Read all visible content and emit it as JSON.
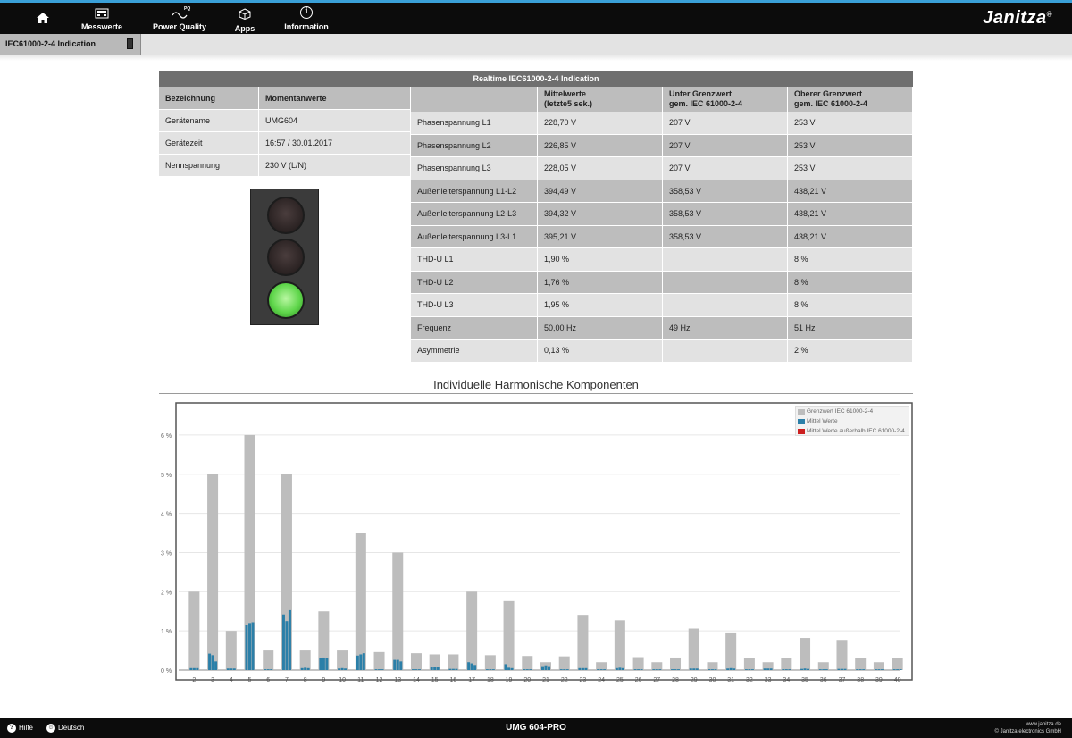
{
  "nav": {
    "items": [
      {
        "label": "Messwerte",
        "icon": "meter-icon"
      },
      {
        "label": "Power Quality",
        "icon": "pq-icon",
        "badge": "PQ"
      },
      {
        "label": "Apps",
        "icon": "cube-icon"
      },
      {
        "label": "Information",
        "icon": "info-icon",
        "glyph": "i"
      }
    ],
    "brand": "Janitza",
    "brand_mark": "®"
  },
  "subbar": {
    "tab_label": "IEC61000-2-4 Indication"
  },
  "panel": {
    "title": "Realtime IEC61000-2-4 Indication",
    "left_headers": [
      "Bezeichnung",
      "Momentanwerte"
    ],
    "left_rows": [
      [
        "Gerätename",
        "UMG604"
      ],
      [
        "Gerätezeit",
        "16:57 / 30.01.2017"
      ],
      [
        "Nennspannung",
        "230 V (L/N)"
      ]
    ],
    "right_headers": {
      "h1a": "Mittelwerte",
      "h1b": "(letzte5 sek.)",
      "h2a": "Unter Grenzwert",
      "h2b": "gem. IEC 61000-2-4",
      "h3a": "Oberer Grenzwert",
      "h3b": "gem. IEC 61000-2-4"
    },
    "right_rows": [
      [
        "Phasenspannung L1",
        "228,70 V",
        "207 V",
        "253 V"
      ],
      [
        "Phasenspannung L2",
        "226,85 V",
        "207 V",
        "253 V"
      ],
      [
        "Phasenspannung L3",
        "228,05 V",
        "207 V",
        "253 V"
      ],
      [
        "Außenleiterspannung L1-L2",
        "394,49 V",
        "358,53 V",
        "438,21 V"
      ],
      [
        "Außenleiterspannung L2-L3",
        "394,32 V",
        "358,53 V",
        "438,21 V"
      ],
      [
        "Außenleiterspannung L3-L1",
        "395,21 V",
        "358,53 V",
        "438,21 V"
      ],
      [
        "THD-U L1",
        "1,90 %",
        "",
        "8 %"
      ],
      [
        "THD-U L2",
        "1,76 %",
        "",
        "8 %"
      ],
      [
        "THD-U L3",
        "1,95 %",
        "",
        "8 %"
      ],
      [
        "Frequenz",
        "50,00 Hz",
        "49 Hz",
        "51 Hz"
      ],
      [
        "Asymmetrie",
        "0,13 %",
        "",
        "2 %"
      ]
    ],
    "traffic_light": {
      "active": "green"
    }
  },
  "chart_section_title": "Individuelle Harmonische Komponenten",
  "chart_data": {
    "type": "bar",
    "categories": [
      "2",
      "3",
      "4",
      "5",
      "6",
      "7",
      "8",
      "9",
      "10",
      "11",
      "12",
      "13",
      "14",
      "15",
      "16",
      "17",
      "18",
      "19",
      "20",
      "21",
      "22",
      "23",
      "24",
      "25",
      "26",
      "27",
      "28",
      "29",
      "30",
      "31",
      "32",
      "33",
      "34",
      "35",
      "36",
      "37",
      "38",
      "39",
      "40"
    ],
    "ylim": [
      0,
      6.5
    ],
    "yticks": [
      0,
      1,
      2,
      3,
      4,
      5,
      6
    ],
    "ytick_labels": [
      "0 %",
      "1 %",
      "2 %",
      "3 %",
      "4 %",
      "5 %",
      "6 %"
    ],
    "legend": [
      "Grenzwert IEC 61000-2-4",
      "Mittel Werte",
      "Mittel Werte außerhalb IEC 61000-2-4"
    ],
    "series": [
      {
        "name": "Grenzwert IEC 61000-2-4",
        "color": "#bdbdbd",
        "values": [
          2,
          5,
          1,
          6,
          0.5,
          5,
          0.5,
          1.5,
          0.5,
          3.5,
          0.46,
          3,
          0.43,
          0.4,
          0.4,
          2,
          0.38,
          1.76,
          0.36,
          0.2,
          0.35,
          1.41,
          0.2,
          1.27,
          0.33,
          0.2,
          0.32,
          1.06,
          0.2,
          0.96,
          0.31,
          0.2,
          0.3,
          0.82,
          0.2,
          0.77,
          0.3,
          0.2,
          0.3
        ]
      },
      {
        "name": "Mittel Werte",
        "color": "#2b7fa8",
        "triplets": [
          [
            0.05,
            0.05,
            0.05
          ],
          [
            0.42,
            0.38,
            0.22
          ],
          [
            0.04,
            0.04,
            0.04
          ],
          [
            1.15,
            1.2,
            1.22
          ],
          [
            0.02,
            0.02,
            0.02
          ],
          [
            1.42,
            1.25,
            1.53
          ],
          [
            0.05,
            0.06,
            0.05
          ],
          [
            0.3,
            0.32,
            0.3
          ],
          [
            0.04,
            0.05,
            0.04
          ],
          [
            0.37,
            0.4,
            0.43
          ],
          [
            0.02,
            0.02,
            0.02
          ],
          [
            0.26,
            0.26,
            0.22
          ],
          [
            0.02,
            0.02,
            0.02
          ],
          [
            0.08,
            0.09,
            0.08
          ],
          [
            0.03,
            0.03,
            0.03
          ],
          [
            0.2,
            0.17,
            0.13
          ],
          [
            0.02,
            0.02,
            0.02
          ],
          [
            0.15,
            0.06,
            0.05
          ],
          [
            0.02,
            0.02,
            0.02
          ],
          [
            0.1,
            0.12,
            0.1
          ],
          [
            0.02,
            0.02,
            0.02
          ],
          [
            0.05,
            0.05,
            0.05
          ],
          [
            0.02,
            0.02,
            0.02
          ],
          [
            0.05,
            0.06,
            0.05
          ],
          [
            0.02,
            0.02,
            0.02
          ],
          [
            0.02,
            0.02,
            0.02
          ],
          [
            0.02,
            0.02,
            0.02
          ],
          [
            0.04,
            0.04,
            0.04
          ],
          [
            0.02,
            0.02,
            0.02
          ],
          [
            0.04,
            0.05,
            0.04
          ],
          [
            0.02,
            0.02,
            0.02
          ],
          [
            0.04,
            0.04,
            0.04
          ],
          [
            0.02,
            0.02,
            0.02
          ],
          [
            0.03,
            0.04,
            0.03
          ],
          [
            0.02,
            0.02,
            0.02
          ],
          [
            0.03,
            0.03,
            0.03
          ],
          [
            0.02,
            0.02,
            0.02
          ],
          [
            0.02,
            0.02,
            0.02
          ],
          [
            0.02,
            0.02,
            0.02
          ]
        ]
      },
      {
        "name": "Mittel Werte außerhalb IEC 61000-2-4",
        "color": "#cc1f1f",
        "values": []
      }
    ]
  },
  "footer": {
    "help": "Hilfe",
    "language": "Deutsch",
    "device": "UMG 604-PRO",
    "website": "www.janitza.de",
    "copyright": "© Janitza electronics GmbH"
  }
}
